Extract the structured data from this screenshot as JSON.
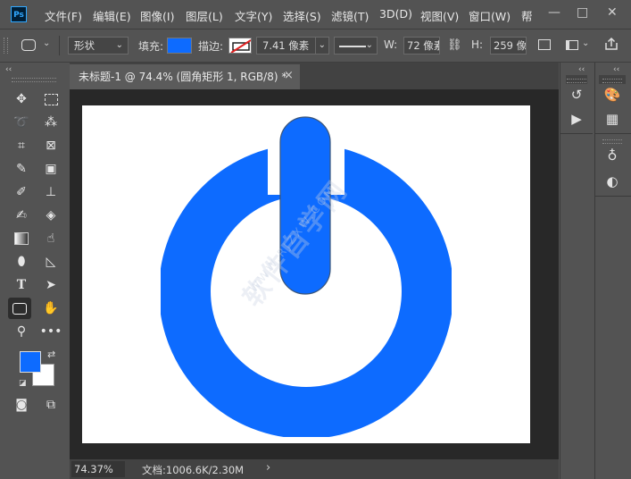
{
  "app": {
    "logo": "Ps"
  },
  "menu": [
    "文件(F)",
    "编辑(E)",
    "图像(I)",
    "图层(L)",
    "文字(Y)",
    "选择(S)",
    "滤镜(T)",
    "3D(D)",
    "视图(V)",
    "窗口(W)",
    "帮"
  ],
  "window_controls": {
    "minimize": "—",
    "maximize": "□",
    "close": "✕"
  },
  "options": {
    "mode": "形状",
    "fill_label": "填充:",
    "fill_color": "#0d6bff",
    "stroke_label": "描边:",
    "stroke_width": "7.41 像素",
    "width_label": "W:",
    "width_value": "72 像素",
    "height_label": "H:",
    "height_value": "259 像"
  },
  "document": {
    "tab_title": "未标题-1 @ 74.4% (圆角矩形 1, RGB/8) *",
    "close": "×"
  },
  "canvas": {
    "shape_color": "#0d6bff",
    "watermark": "软件自学网",
    "watermark_url": "WWW.RJZXW.COM"
  },
  "status": {
    "zoom": "74.37%",
    "doc_info": "文档:1006.6K/2.30M",
    "arrow": "›"
  },
  "tools": {
    "collapse": "‹‹",
    "foreground_color": "#0d6bff",
    "background_color": "#ffffff"
  },
  "right_panels": {
    "collapse": "‹‹"
  }
}
